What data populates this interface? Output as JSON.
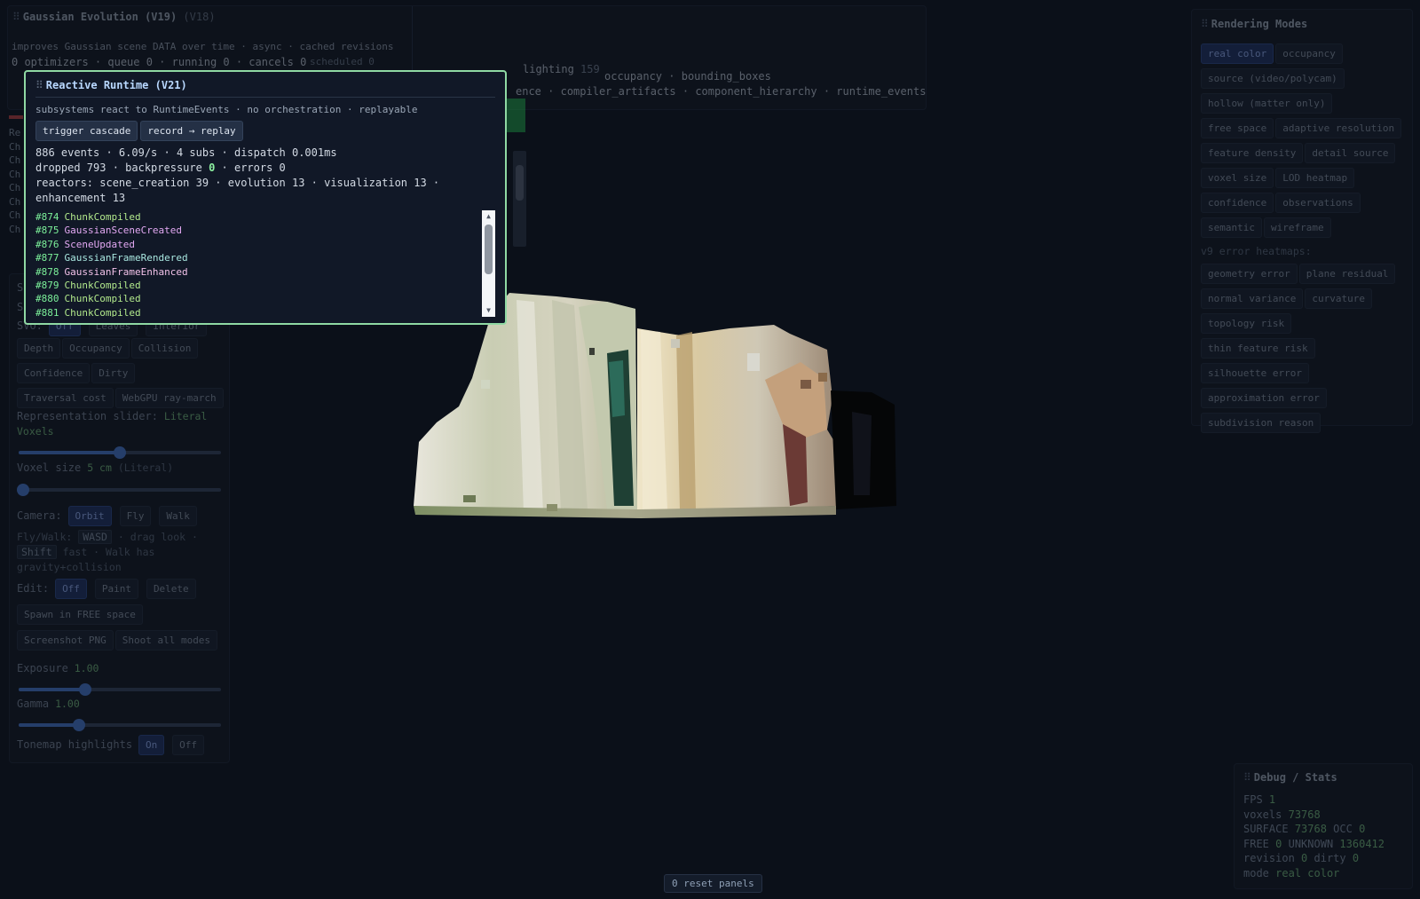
{
  "gaussian_panel": {
    "title": "Gaussian Evolution (V19)",
    "ghost_title": "(V18)",
    "line1": "improves Gaussian scene DATA over time · async · cached revisions",
    "line2": "0 optimizers · queue 0 · running 0 · cancels 0",
    "line3_fragment": "scheduled 0",
    "row_labels": [
      "Re",
      "Ch",
      "Ch",
      "Ch",
      "Ch",
      "Ch",
      "Ch",
      "Ch"
    ]
  },
  "ghost_panel": {
    "line1": "lighting",
    "line1_number": "159",
    "row1": [
      "occupancy",
      "bounding_boxes"
    ],
    "row2": [
      "ence",
      "compiler_artifacts",
      "component_hierarchy",
      "runtime_events"
    ]
  },
  "reactive": {
    "title": "Reactive Runtime (V21)",
    "subtitle": "subsystems react to RuntimeEvents · no orchestration · replayable",
    "buttons": [
      "trigger cascade",
      "record → replay"
    ],
    "stats_line1": "886 events · 6.09/s · 4 subs · dispatch 0.001ms",
    "stats_line2_pre": "dropped 793 · backpressure ",
    "stats_line2_value": "0",
    "stats_line2_post": " · errors 0",
    "reactors_line": "reactors: scene_creation 39 · evolution 13 · visualization 13 ·",
    "reactors_line2": "enhancement 13",
    "log": [
      {
        "num": "#874",
        "event": "ChunkCompiled",
        "kind": "chunk"
      },
      {
        "num": "#875",
        "event": "GaussianSceneCreated",
        "kind": "created"
      },
      {
        "num": "#876",
        "event": "SceneUpdated",
        "kind": "updated"
      },
      {
        "num": "#877",
        "event": "GaussianFrameRendered",
        "kind": "rendered"
      },
      {
        "num": "#878",
        "event": "GaussianFrameEnhanced",
        "kind": "enhanced"
      },
      {
        "num": "#879",
        "event": "ChunkCompiled",
        "kind": "chunk"
      },
      {
        "num": "#880",
        "event": "ChunkCompiled",
        "kind": "chunk"
      },
      {
        "num": "#881",
        "event": "ChunkCompiled",
        "kind": "chunk"
      }
    ]
  },
  "controls": {
    "svo_label": "SVO:",
    "svo_modes": [
      "Off",
      "Leaves",
      "Interior"
    ],
    "svo_rows": [
      [
        "Depth",
        "Occupancy",
        "Collision"
      ],
      [
        "Confidence",
        "Dirty"
      ],
      [
        "Traversal cost",
        "WebGPU ray-march"
      ]
    ],
    "rep_label": "Representation slider:",
    "rep_value": "Literal",
    "rep_value2": "Voxels",
    "rep_level": 0.5,
    "voxel_label": "Voxel size",
    "voxel_value": "5 cm",
    "voxel_hint": "(Literal)",
    "voxel_level": 0.0,
    "camera_label": "Camera:",
    "camera_modes": [
      "Orbit",
      "Fly",
      "Walk"
    ],
    "flywalk_pre": "Fly/Walk:",
    "flywalk_key1": "WASD",
    "flywalk_mid": "· drag look ·",
    "flywalk_key2": "Shift",
    "flywalk_post": "fast · Walk has",
    "flywalk_line3": "gravity+collision",
    "edit_label": "Edit:",
    "edit_modes": [
      "Off",
      "Paint",
      "Delete"
    ],
    "spawn_button": "Spawn in FREE space",
    "screenshot_button": "Screenshot PNG",
    "shoot_button": "Shoot all modes",
    "exposure_label": "Exposure",
    "exposure_value": "1.00",
    "exposure_level": 0.33,
    "gamma_label": "Gamma",
    "gamma_value": "1.00",
    "gamma_level": 0.3,
    "tonemap_label": "Tonemap highlights",
    "tonemap_modes": [
      "On",
      "Off"
    ],
    "partial_labels": [
      "S",
      "S"
    ]
  },
  "rendering_modes": {
    "title": "Rendering Modes",
    "chips_rows": [
      [
        "real color",
        "occupancy"
      ],
      [
        "source (video/polycam)"
      ],
      [
        "hollow (matter only)"
      ],
      [
        "free space",
        "adaptive resolution"
      ],
      [
        "feature density",
        "detail source"
      ],
      [
        "voxel size",
        "LOD heatmap"
      ],
      [
        "confidence",
        "observations"
      ],
      [
        "semantic",
        "wireframe"
      ]
    ],
    "heatmaps_label": "v9 error heatmaps:",
    "heatmap_rows": [
      [
        "geometry error",
        "plane residual"
      ],
      [
        "normal variance",
        "curvature"
      ],
      [
        "topology risk"
      ],
      [
        "thin feature risk"
      ],
      [
        "silhouette error"
      ],
      [
        "approximation error"
      ],
      [
        "subdivision reason"
      ]
    ]
  },
  "debug": {
    "title": "Debug / Stats",
    "fps_label": "FPS",
    "fps": "1",
    "voxels_label": "voxels",
    "voxels": "73768",
    "surface_label": "SURFACE",
    "surface": "73768",
    "occ_label": "OCC",
    "occ": "0",
    "free_label": "FREE",
    "free": "0",
    "unknown_label": "UNKNOWN",
    "unknown": "1360412",
    "revision_label": "revision",
    "revision": "0",
    "dirty_label": "dirty",
    "dirty": "0",
    "mode_label": "mode",
    "mode": "real color"
  },
  "reset_button": "0 reset panels",
  "colors": {
    "accent": "#4a7fd9",
    "runtime_border": "#8fd9a3",
    "stat_green": "#7ac27e"
  }
}
